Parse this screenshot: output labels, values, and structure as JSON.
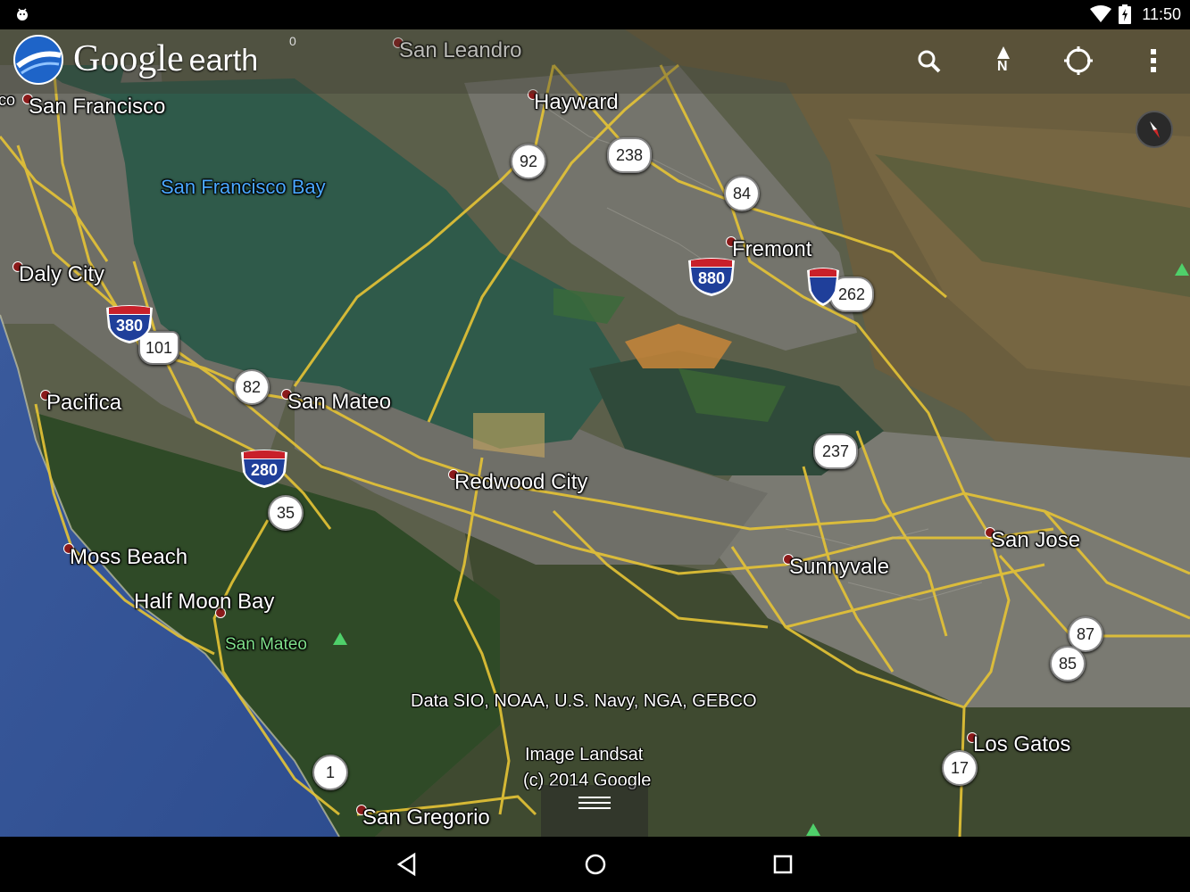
{
  "status_bar": {
    "time": "11:50"
  },
  "app": {
    "logo_google": "Google",
    "logo_earth": "earth",
    "logo_mark": "0"
  },
  "toolbar": {
    "icons": [
      "search-icon",
      "north-icon",
      "my-location-icon",
      "overflow-menu-icon"
    ],
    "north_letter": "N"
  },
  "places": [
    {
      "name": "San Leandro"
    },
    {
      "name": "Hayward"
    },
    {
      "name": "San Francisco"
    },
    {
      "name": "Daly City"
    },
    {
      "name": "Fremont"
    },
    {
      "name": "Pacifica"
    },
    {
      "name": "San Mateo"
    },
    {
      "name": "Redwood City"
    },
    {
      "name": "San Jose"
    },
    {
      "name": "Sunnyvale"
    },
    {
      "name": "Moss Beach"
    },
    {
      "name": "Half Moon Bay"
    },
    {
      "name": "Los Gatos"
    },
    {
      "name": "San Gregorio"
    }
  ],
  "water_label": "San Francisco Bay",
  "edge_label": "co",
  "park_label": "San Mateo",
  "routes": {
    "state": [
      "92",
      "238",
      "84",
      "262",
      "82",
      "35",
      "237",
      "87",
      "85",
      "17",
      "1"
    ],
    "us": [
      "101"
    ],
    "interstate": [
      "380",
      "880",
      "280"
    ]
  },
  "credits": {
    "data": "Data SIO, NOAA, U.S. Navy, NGA, GEBCO",
    "image_line1": "Image Landsat",
    "image_line2": "(c) 2014 Google"
  },
  "navigation": {
    "icons": [
      "back-icon",
      "home-icon",
      "recents-icon"
    ]
  }
}
